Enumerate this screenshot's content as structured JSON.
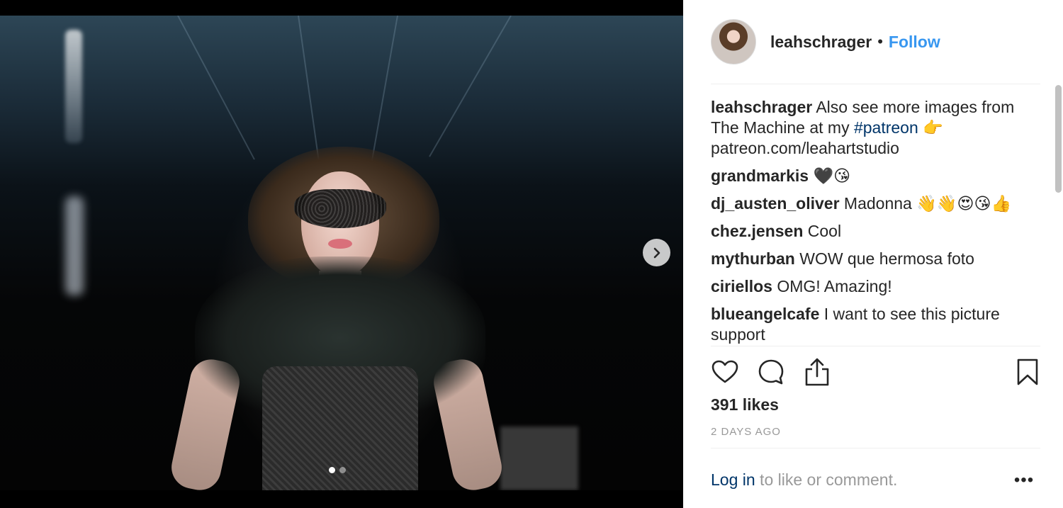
{
  "post": {
    "username": "leahschrager",
    "separator": "•",
    "follow_label": "Follow"
  },
  "comments": [
    {
      "user": "leahschrager",
      "text_before": "Also see more images from The Machine at my ",
      "tag": "#patreon",
      "text_after": " 👉 patreon.com/leahartstudio"
    },
    {
      "user": "grandmarkis",
      "text": "🖤😘"
    },
    {
      "user": "dj_austen_oliver",
      "text": "Madonna 👋👋😍😘👍"
    },
    {
      "user": "chez.jensen",
      "text": "Cool"
    },
    {
      "user": "mythurban",
      "text": "WOW que hermosa foto"
    },
    {
      "user": "ciriellos",
      "text": "OMG! Amazing!"
    },
    {
      "user": "blueangelcafe",
      "text": "I want to see this picture support"
    }
  ],
  "likes": "391 likes",
  "timestamp": "2 DAYS AGO",
  "footer": {
    "login": "Log in",
    "rest": " to like or comment.",
    "more": "•••"
  },
  "carousel": {
    "current": 1,
    "total": 2
  },
  "colors": {
    "link": "#3897f0",
    "hashtag": "#003569",
    "text": "#262626",
    "muted": "#999999"
  },
  "icons": [
    "chevron-right-icon",
    "heart-icon",
    "comment-icon",
    "share-icon",
    "bookmark-icon",
    "more-icon"
  ]
}
